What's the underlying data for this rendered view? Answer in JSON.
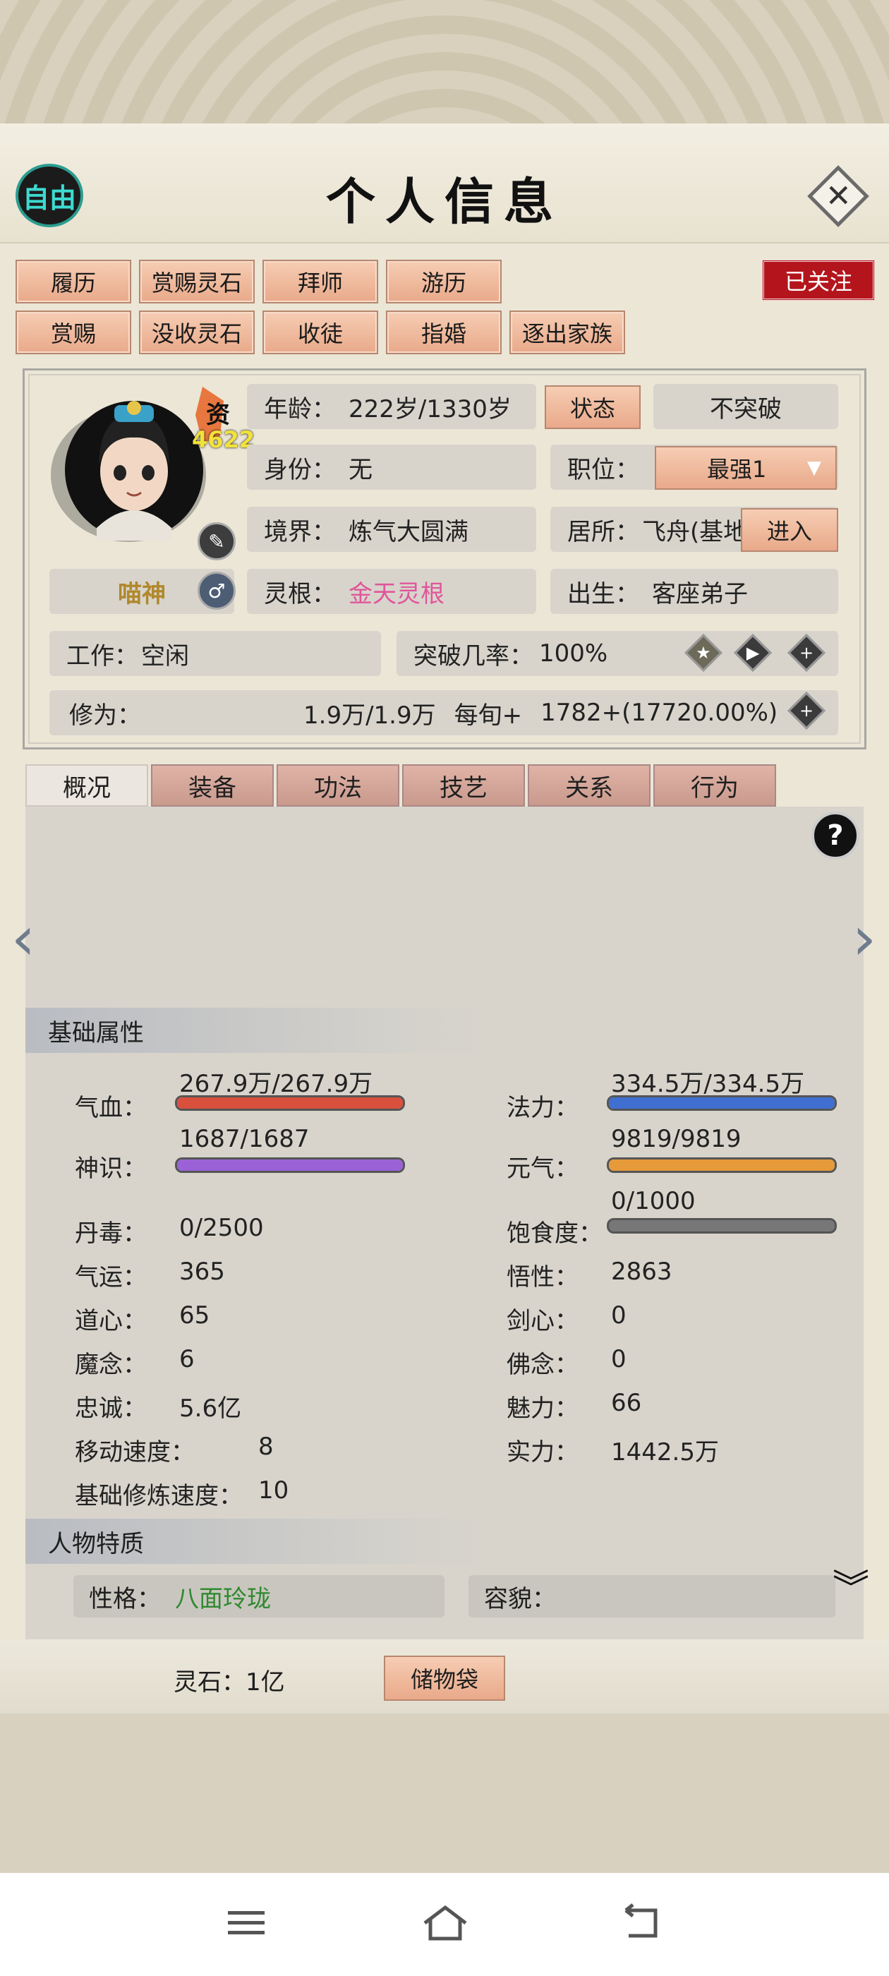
{
  "header": {
    "mode_badge": "自由",
    "title": "个人信息"
  },
  "actions": {
    "row1": [
      "履历",
      "赏赐灵石",
      "拜师",
      "游历"
    ],
    "row2": [
      "赏赐",
      "没收灵石",
      "收徒",
      "指婚",
      "逐出家族"
    ],
    "follow_badge": "已关注"
  },
  "profile": {
    "aptitude_label": "资",
    "aptitude_value": "4622",
    "name": "喵神",
    "gender_icon": "male-icon",
    "age_label": "年龄：",
    "age_value": "222岁/1330岁",
    "status_button": "状态",
    "breakthrough_button": "不突破",
    "identity_label": "身份：",
    "identity_value": "无",
    "position_label": "职位：",
    "position_value": "最强1",
    "realm_label": "境界：",
    "realm_value": "炼气大圆满",
    "residence_label": "居所：",
    "residence_value": "飞舟(基地",
    "enter_button": "进入",
    "root_label": "灵根：",
    "root_value": "金天灵根",
    "root_color": "#e0569a",
    "birth_label": "出生：",
    "birth_value": "客座弟子",
    "work_label": "工作：",
    "work_value": "空闲",
    "rate_label": "突破几率：",
    "rate_value": "100%",
    "cultivation_label": "修为：",
    "cultivation_value": "1.9万/1.9万",
    "per_turn_label": "每旬+",
    "per_turn_value": "1782+(17720.00%)"
  },
  "tabs": [
    "概况",
    "装备",
    "功法",
    "技艺",
    "关系",
    "行为"
  ],
  "active_tab": 0,
  "basic_section_title": "基础属性",
  "stats": {
    "hp_label": "气血：",
    "hp_value": "267.9万/267.9万",
    "hp_fill": 1.0,
    "hp_color": "#d9503c",
    "mp_label": "法力：",
    "mp_value": "334.5万/334.5万",
    "mp_fill": 1.0,
    "mp_color": "#3f6fd0",
    "sense_label": "神识：",
    "sense_value": "1687/1687",
    "sense_fill": 1.0,
    "sense_color": "#9a62d6",
    "vital_label": "元气：",
    "vital_value": "9819/9819",
    "vital_fill": 1.0,
    "vital_color": "#e79a3a",
    "satiety_label": "饱食度：",
    "satiety_value": "0/1000",
    "satiety_fill": 0.0,
    "poison_label": "丹毒：",
    "poison_value": "0/2500",
    "luck_label": "气运：",
    "luck_value": "365",
    "wisdom_label": "悟性：",
    "wisdom_value": "2863",
    "dao_label": "道心：",
    "dao_value": "65",
    "sword_label": "剑心：",
    "sword_value": "0",
    "demon_label": "魔念：",
    "demon_value": "6",
    "buddha_label": "佛念：",
    "buddha_value": "0",
    "loyalty_label": "忠诚：",
    "loyalty_value": "5.6亿",
    "charm_label": "魅力：",
    "charm_value": "66",
    "speed_label": "移动速度：",
    "speed_value": "8",
    "power_label": "实力：",
    "power_value": "1442.5万",
    "train_label": "基础修炼速度：",
    "train_value": "10"
  },
  "traits_section_title": "人物特质",
  "traits": {
    "personality_label": "性格：",
    "personality_value": "八面玲珑",
    "personality_color": "#2f8a2f",
    "looks_label": "容貌："
  },
  "footer": {
    "spirit_stone_label": "灵石：",
    "spirit_stone_value": "1亿",
    "storage_button": "储物袋"
  }
}
